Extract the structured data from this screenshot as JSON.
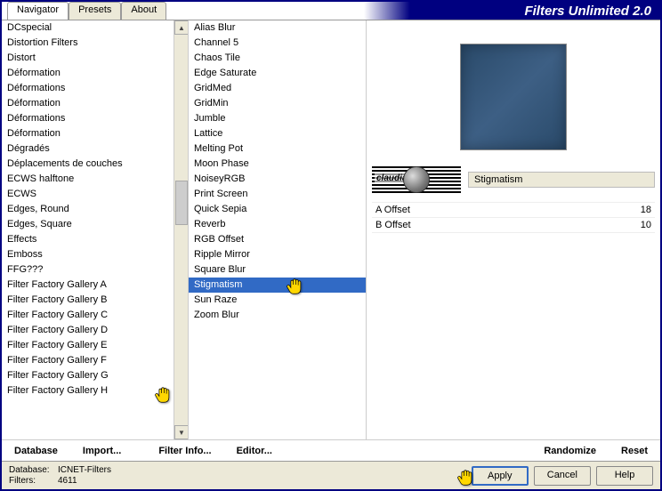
{
  "title": "Filters Unlimited 2.0",
  "tabs": [
    "Navigator",
    "Presets",
    "About"
  ],
  "active_tab": 0,
  "categories": [
    "DCspecial",
    "Distortion Filters",
    "Distort",
    "Déformation",
    "Déformations",
    "Déformation",
    "Déformations",
    "Déformation",
    "Dégradés",
    "Déplacements de couches",
    "ECWS halftone",
    "ECWS",
    "Edges, Round",
    "Edges, Square",
    "Effects",
    "Emboss",
    "FFG???",
    "Filter Factory Gallery A",
    "Filter Factory Gallery B",
    "Filter Factory Gallery C",
    "Filter Factory Gallery D",
    "Filter Factory Gallery E",
    "Filter Factory Gallery F",
    "Filter Factory Gallery G",
    "Filter Factory Gallery H"
  ],
  "filters": [
    "Alias Blur",
    "Channel 5",
    "Chaos Tile",
    "Edge Saturate",
    "GridMed",
    "GridMin",
    "Jumble",
    "Lattice",
    "Melting Pot",
    "Moon Phase",
    "NoiseyRGB",
    "Print Screen",
    "Quick Sepia",
    "Reverb",
    "RGB Offset",
    "Ripple Mirror",
    "Square Blur",
    "Stigmatism",
    "Sun Raze",
    "Zoom Blur"
  ],
  "selected_filter_index": 17,
  "watermark_label": "claudia",
  "current_filter": "Stigmatism",
  "params": [
    {
      "name": "A Offset",
      "value": "18"
    },
    {
      "name": "B Offset",
      "value": "10"
    }
  ],
  "toolbar": {
    "database": "Database",
    "import": "Import...",
    "filter_info": "Filter Info...",
    "editor": "Editor...",
    "randomize": "Randomize",
    "reset": "Reset"
  },
  "footer": {
    "db_label": "Database:",
    "db_value": "ICNET-Filters",
    "filters_label": "Filters:",
    "filters_value": "4611",
    "apply": "Apply",
    "cancel": "Cancel",
    "help": "Help"
  }
}
